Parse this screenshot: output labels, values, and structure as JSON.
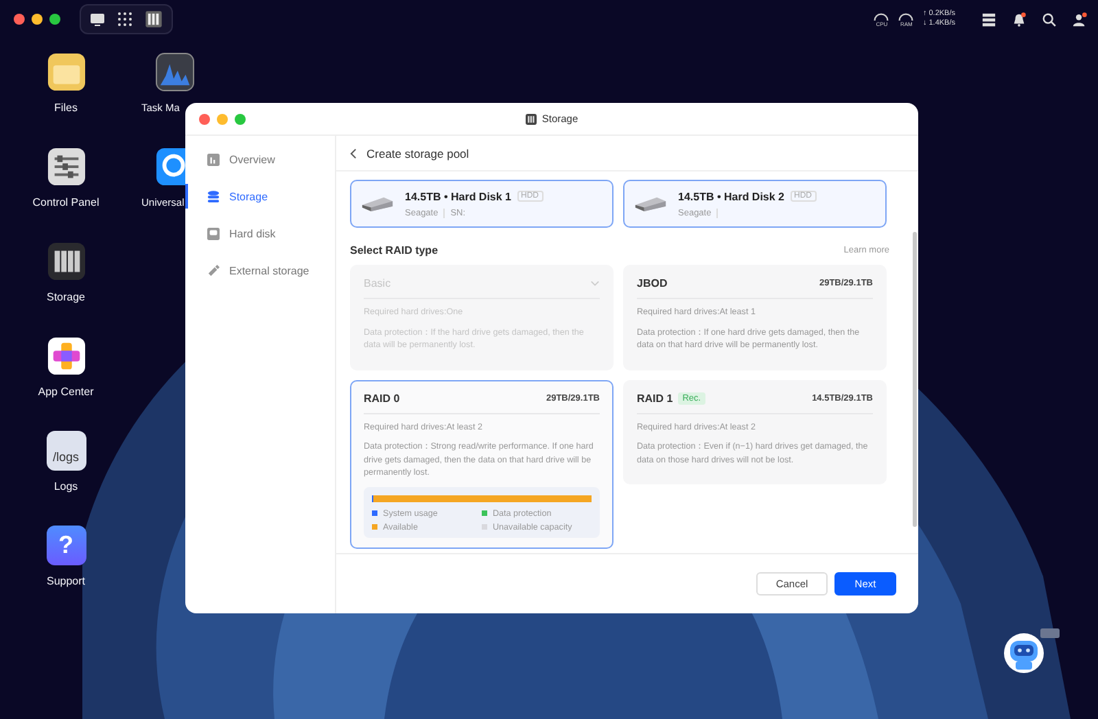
{
  "menu_bar": {
    "gauges": [
      "CPU",
      "RAM"
    ],
    "net_up": "↑ 0.2KB/s",
    "net_down": "↓ 1.4KB/s"
  },
  "desktop_column_1": [
    {
      "label": "Files",
      "kind": "files"
    },
    {
      "label": "Control Panel",
      "kind": "panel"
    },
    {
      "label": "Storage",
      "kind": "storage"
    },
    {
      "label": "App Center",
      "kind": "apps"
    },
    {
      "label": "Logs",
      "kind": "logs",
      "text": "/logs"
    },
    {
      "label": "Support",
      "kind": "support",
      "text": "?"
    }
  ],
  "desktop_column_2": [
    {
      "label": "Task Ma",
      "kind": "monitor"
    },
    {
      "label": "Universal",
      "kind": "search"
    }
  ],
  "window": {
    "title": "Storage",
    "sidebar": [
      {
        "label": "Overview",
        "kind": "overview",
        "selected": false
      },
      {
        "label": "Storage",
        "kind": "storage",
        "selected": true
      },
      {
        "label": "Hard disk",
        "kind": "disk",
        "selected": false
      },
      {
        "label": "External storage",
        "kind": "external",
        "selected": false
      }
    ],
    "header": "Create storage pool",
    "disks": [
      {
        "name": "14.5TB • Hard Disk 1",
        "tag": "HDD",
        "vendor": "Seagate",
        "serial": "SN:",
        "selected": true
      },
      {
        "name": "14.5TB • Hard Disk 2",
        "tag": "HDD",
        "vendor": "Seagate",
        "selected": true
      }
    ],
    "raid_title": "Select RAID type",
    "learn_more": "Learn more",
    "raid_options": [
      {
        "name": "Basic",
        "disabled": true,
        "selected": false,
        "required": "Required hard drives:One",
        "protection": "Data protection：If the hard drive gets damaged, then the data will be permanently lost."
      },
      {
        "name": "JBOD",
        "capacity": "29TB/29.1TB",
        "disabled": false,
        "selected": false,
        "required": "Required hard drives:At least 1",
        "protection": "Data protection：If one hard drive gets damaged, then the data on that hard drive will be permanently lost."
      },
      {
        "name": "RAID 0",
        "capacity": "29TB/29.1TB",
        "disabled": false,
        "selected": true,
        "required": "Required hard drives:At least 2",
        "protection": "Data protection：Strong read/write performance. If one hard drive gets damaged, then the data on that hard drive will be permanently lost.",
        "usage": {
          "color": "#f5a623",
          "bars": [
            {
              "color": "#2f6bff",
              "level": 0.006
            }
          ],
          "legend": [
            {
              "label": "System usage",
              "color": "#2f6bff"
            },
            {
              "label": "Data protection",
              "color": "#3cc35a"
            },
            {
              "label": "Available",
              "color": "#f5a623"
            },
            {
              "label": "Unavailable capacity",
              "color": "#d9d9de"
            }
          ]
        }
      },
      {
        "name": "RAID 1",
        "badge": "Rec.",
        "capacity": "14.5TB/29.1TB",
        "disabled": false,
        "selected": false,
        "required": "Required hard drives:At least 2",
        "protection": "Data protection：Even if (n−1) hard drives get damaged, the data on those hard drives will not be lost."
      }
    ],
    "buttons": [
      {
        "label": "Cancel",
        "kind": "secondary"
      },
      {
        "label": "Next",
        "kind": "primary"
      }
    ]
  }
}
